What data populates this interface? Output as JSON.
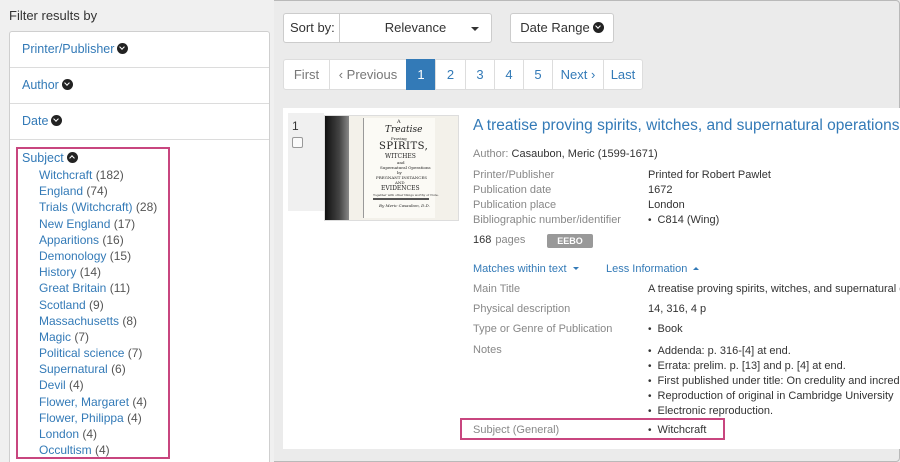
{
  "sidebar": {
    "title": "Filter results by",
    "facets": [
      {
        "label": "Printer/Publisher"
      },
      {
        "label": "Author"
      },
      {
        "label": "Date"
      }
    ],
    "subject": {
      "label": "Subject",
      "items": [
        {
          "name": "Witchcraft",
          "count": "(182)"
        },
        {
          "name": "England",
          "count": "(74)"
        },
        {
          "name": "Trials (Witchcraft)",
          "count": "(28)"
        },
        {
          "name": "New England",
          "count": "(17)"
        },
        {
          "name": "Apparitions",
          "count": "(16)"
        },
        {
          "name": "Demonology",
          "count": "(15)"
        },
        {
          "name": "History",
          "count": "(14)"
        },
        {
          "name": "Great Britain",
          "count": "(11)"
        },
        {
          "name": "Scotland",
          "count": "(9)"
        },
        {
          "name": "Massachusetts",
          "count": "(8)"
        },
        {
          "name": "Magic",
          "count": "(7)"
        },
        {
          "name": "Political science",
          "count": "(7)"
        },
        {
          "name": "Supernatural",
          "count": "(6)"
        },
        {
          "name": "Devil",
          "count": "(4)"
        },
        {
          "name": "Flower, Margaret",
          "count": "(4)"
        },
        {
          "name": "Flower, Philippa",
          "count": "(4)"
        },
        {
          "name": "London",
          "count": "(4)"
        },
        {
          "name": "Occultism",
          "count": "(4)"
        }
      ]
    }
  },
  "toolbar": {
    "sort_label": "Sort by:",
    "sort_value": "Relevance",
    "date_range_label": "Date Range"
  },
  "pagination": {
    "first": "First",
    "prev": "‹ Previous",
    "pages": [
      "1",
      "2",
      "3",
      "4",
      "5"
    ],
    "active_page": "1",
    "next": "Next ›",
    "last": "Last"
  },
  "result": {
    "number": "1",
    "title": "A treatise proving spirits, witches, and supernatural operations,",
    "author_label": "Author:",
    "author": "Casaubon, Meric (1599-1671)",
    "meta": [
      {
        "key": "Printer/Publisher",
        "value": "Printed for Robert Pawlet"
      },
      {
        "key": "Publication date",
        "value": "1672"
      },
      {
        "key": "Publication place",
        "value": "London"
      },
      {
        "key": "Bibliographic number/identifier",
        "value": "C814  (Wing)"
      }
    ],
    "pages_count": "168",
    "pages_label": "pages",
    "badge": "EEBO",
    "matches_label": "Matches within text",
    "less_label": "Less Information",
    "details": [
      {
        "key": "Main Title",
        "value": "A treatise proving spirits, witches, and supernatural o"
      },
      {
        "key": "Physical description",
        "value": "14, 316, 4 p"
      },
      {
        "key": "Type or Genre of Publication",
        "value": "Book"
      }
    ],
    "notes_label": "Notes",
    "notes": [
      "Addenda: p. 316-[4] at end.",
      "Errata: prelim. p. [13] and p. [4] at end.",
      "First published under title: On credulity and incred",
      "Reproduction of original in Cambridge University",
      "Electronic reproduction."
    ],
    "subject_general_label": "Subject (General)",
    "subject_general_value": "Witchcraft",
    "thumbnail_text": {
      "l1": "A",
      "l2": "Treatise",
      "l3": "Proving",
      "l4": "SPIRITS,",
      "l5": "WITCHES",
      "l6": "and",
      "l7": "Supernatural Operations",
      "l8": "by",
      "l9": "PREGNANT INSTANCES",
      "l10": "AND",
      "l11": "EVIDENCES",
      "l12": "Together with other things worthy of Note.",
      "l13": "By Meric Casaubon, D.D."
    }
  },
  "colors": {
    "link": "#337ab7",
    "highlight": "#c8467f",
    "badge": "#999999"
  }
}
